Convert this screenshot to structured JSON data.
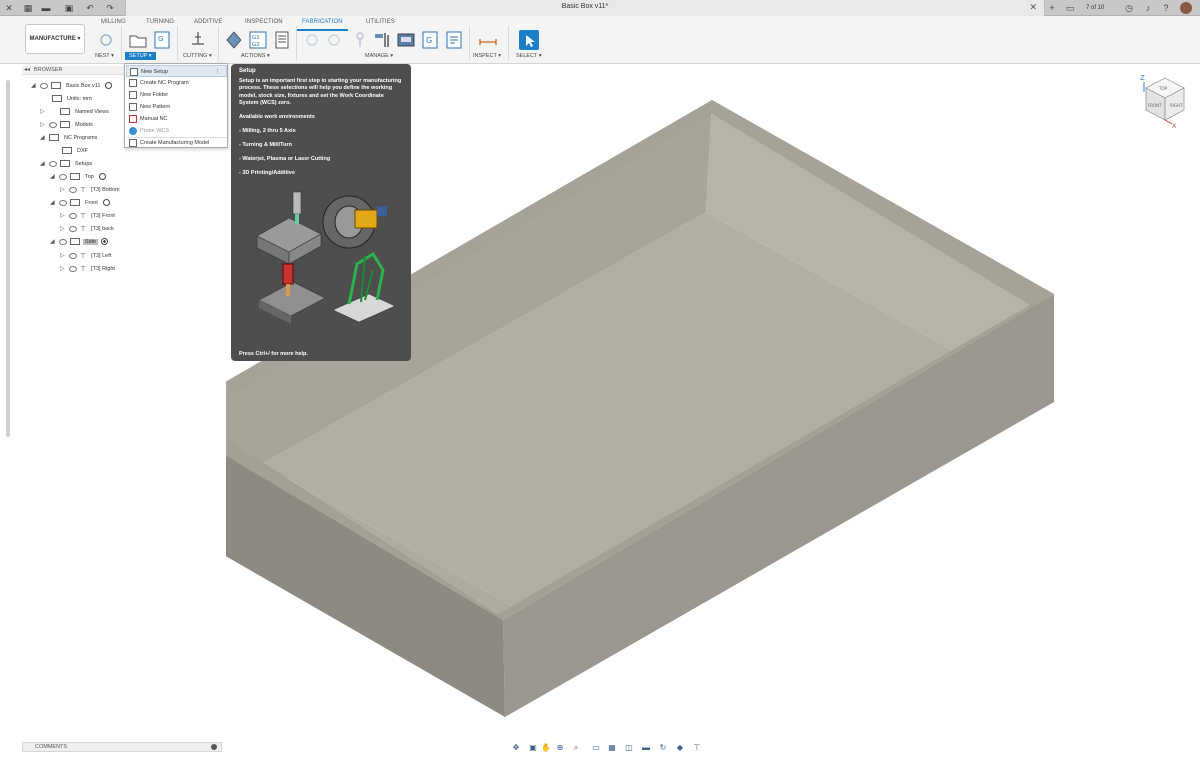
{
  "titlebar": {
    "document_title": "Basic Box v11*",
    "pager": "7 of 10",
    "icons": [
      "close-icon",
      "grid-icon",
      "file-icon",
      "save-icon",
      "undo-icon",
      "redo-icon",
      "new-tab-icon",
      "chat-icon",
      "clock-icon",
      "bell-icon",
      "help-icon",
      "avatar"
    ]
  },
  "ribbon": {
    "workspace_button": "MANUFACTURE ▾",
    "tabs": [
      "MILLING",
      "TURNING",
      "ADDITIVE",
      "INSPECTION",
      "FABRICATION",
      "UTILITIES"
    ],
    "active_tab": "FABRICATION",
    "groups": {
      "nest": "NEST ▾",
      "setup": "SETUP ▾",
      "cutting": "CUTTING ▾",
      "actions": "ACTIONS ▾",
      "manage": "MANAGE ▾",
      "inspect": "INSPECT ▾",
      "select": "SELECT ▾"
    },
    "accent_color": "#1b7ec9"
  },
  "browser": {
    "header": "BROWSER",
    "tree": {
      "root": "Basic Box v11",
      "units": "Units: mm",
      "named_views": "Named Views",
      "models": "Models",
      "nc_programs": "NC Programs",
      "dxf": "DXF",
      "setups": "Setups",
      "top": "Top",
      "top_bottom": "[T3] Bottom",
      "front": "Front",
      "front_front": "[T3] Front",
      "front_back": "[T3] back",
      "side": "Side",
      "side_left": "[T3] Left",
      "side_right": "[T3] Right"
    }
  },
  "setup_menu": {
    "items": [
      {
        "label": "New Setup"
      },
      {
        "label": "Create NC Program"
      },
      {
        "label": "New Folder"
      },
      {
        "label": "New Pattern"
      },
      {
        "label": "Manual NC"
      },
      {
        "label": "Probe WCS"
      },
      {
        "label": "Create Manufacturing Model"
      }
    ],
    "more_icon": "⋮"
  },
  "tooltip": {
    "title": "Setup",
    "description": "Setup is an important first step in starting your manufacturing process. These selections will help you define the working model, stock size, fixtures and set the Work Coordinate System (WCS) zero.",
    "heading": "Available work environments",
    "items": [
      "- Milling, 2 thru 5 Axis",
      "- Turning & Mill/Turn",
      "- Waterjet, Plasma or Laser Cutting",
      "- 3D Printing/Additive"
    ],
    "footer": "Press Ctrl+/ for more help."
  },
  "comments": {
    "label": "COMMENTS"
  },
  "viewcube": {
    "axis_z": "Z",
    "axis_x": "X",
    "face_top": "TOP",
    "face_front": "FRONT",
    "face_right": "RIGHT"
  },
  "model_colors": {
    "top_face": "#aaa59b",
    "front_face": "#8c877e",
    "right_face": "#9c978d",
    "floor": "#b5b0a6"
  }
}
